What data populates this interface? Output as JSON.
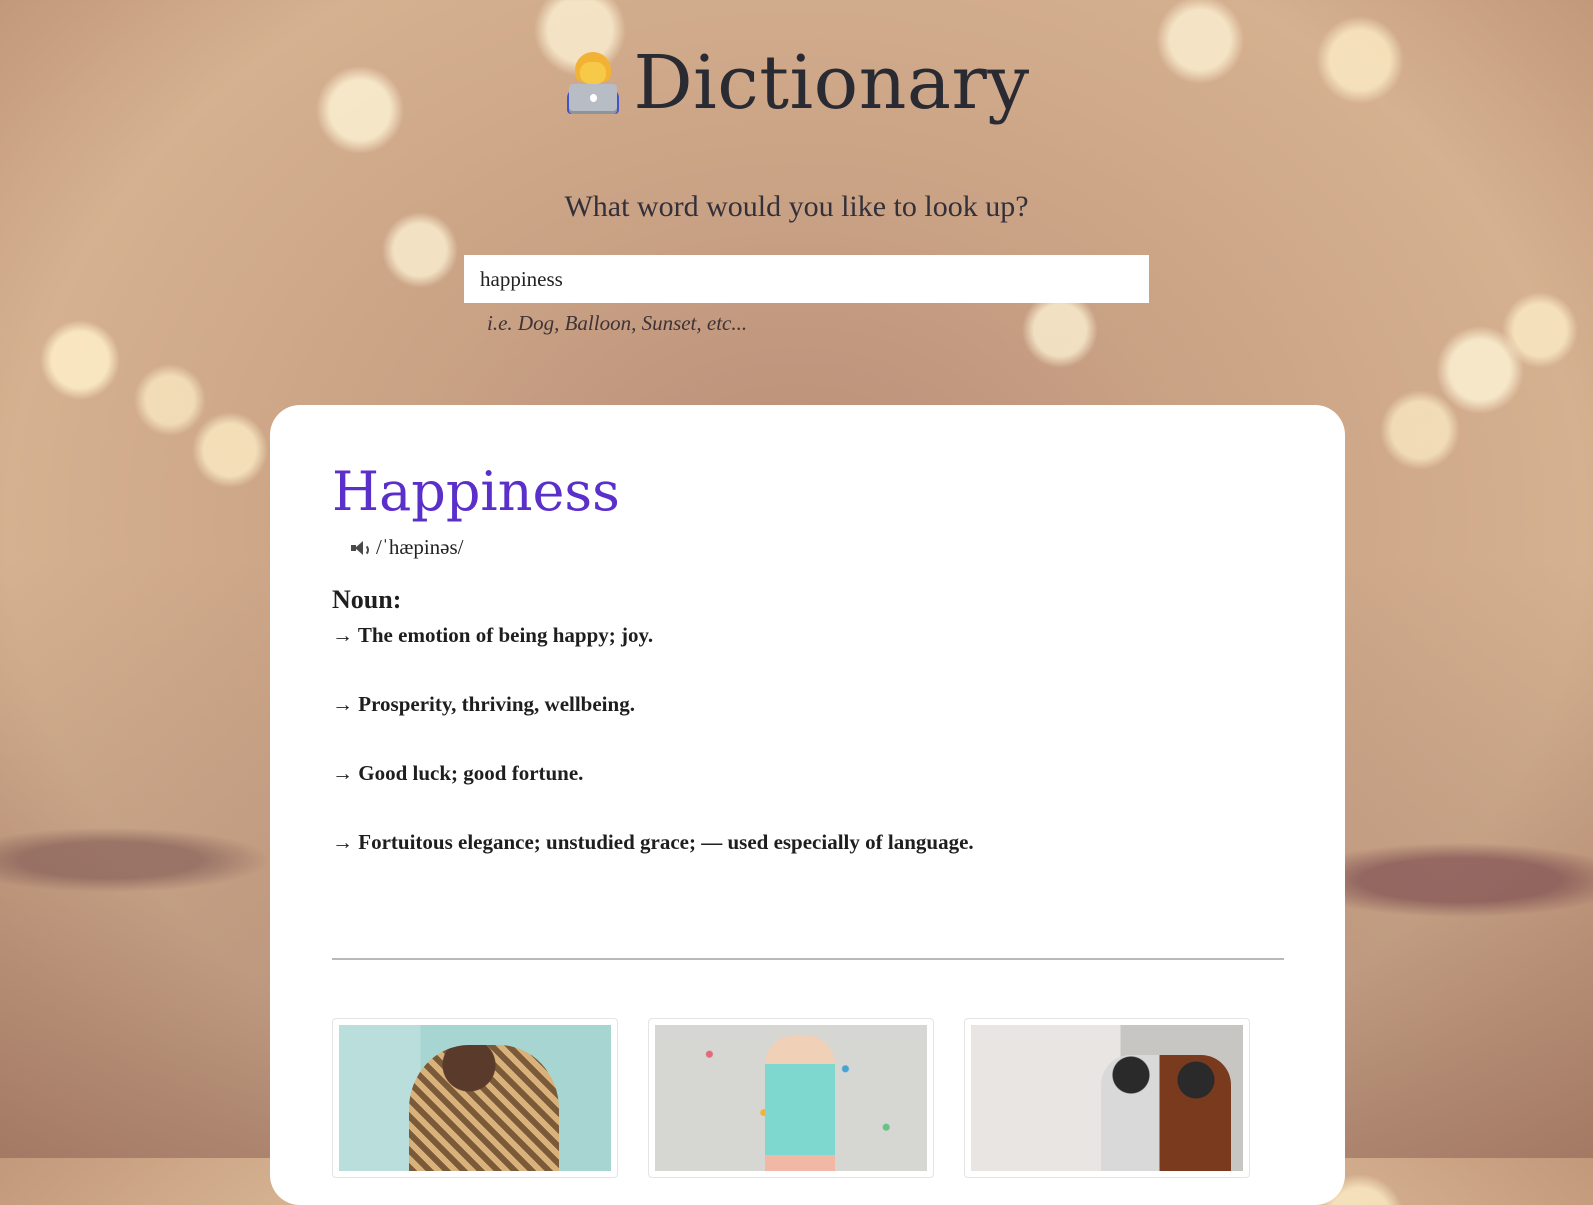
{
  "header": {
    "title": "Dictionary",
    "title_icon": "woman-technologist-icon"
  },
  "search": {
    "prompt": "What word would you like to look up?",
    "value": "happiness",
    "hint": "i.e. Dog, Balloon, Sunset, etc..."
  },
  "result": {
    "word": "Happiness",
    "phonetic": "/ˈhæpinəs/",
    "audio_icon": "speaker-icon",
    "part_of_speech": "Noun:",
    "definitions": [
      "→ The emotion of being happy; joy.",
      "→ Prosperity, thriving, wellbeing.",
      "→ Good luck; good fortune.",
      "→ Fortuitous elegance; unstudied grace; — used especially of language."
    ]
  },
  "colors": {
    "word": "#5b2fc9",
    "card": "#ffffff"
  }
}
